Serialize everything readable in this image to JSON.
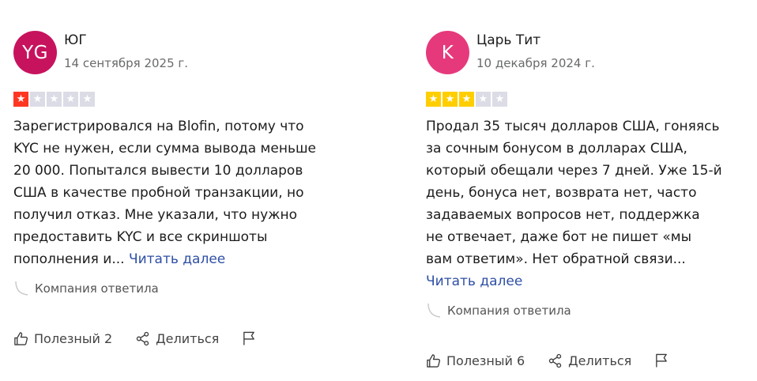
{
  "reviews": [
    {
      "initials": "YG",
      "avatar_color": "#c7135e",
      "name": "ЮГ",
      "date": "14 сентября 2025 г.",
      "rating": 1,
      "star_color": "#ff3722",
      "lines": [
        "Зарегистрировался на Blofin, потому что",
        "KYC не нужен, если сумма вывода меньше",
        "20 000. Попытался вывести 10 долларов",
        "США в качестве пробной транзакции, но",
        "получил отказ. Мне указали, что нужно",
        "предоставить KYC и все скриншоты",
        "пополнения и..."
      ],
      "read_more": "Читать далее",
      "company_replied": "Компания ответила",
      "helpful": "Полезный 2",
      "share": "Делиться"
    },
    {
      "initials": "K",
      "avatar_color": "#e6397c",
      "name": "Царь Тит",
      "date": "10 декабря 2024 г.",
      "rating": 3,
      "star_color": "#ffce00",
      "lines": [
        "Продал 35 тысяч долларов США, гоняясь",
        "за сочным бонусом в долларах США,",
        "который обещали через 7 дней. Уже 15-й",
        "день, бонуса нет, возврата нет, часто",
        "задаваемых вопросов нет, поддержка",
        "не отвечает, даже бот не пишет «мы",
        "вам ответим». Нет обратной связи..."
      ],
      "read_more": "Читать далее",
      "company_replied": "Компания ответила",
      "helpful": "Полезный 6",
      "share": "Делиться"
    }
  ],
  "icons": {
    "star": "★",
    "reply": "reply-curve-icon",
    "like": "thumbs-up-icon",
    "share": "share-icon",
    "flag": "flag-icon"
  }
}
